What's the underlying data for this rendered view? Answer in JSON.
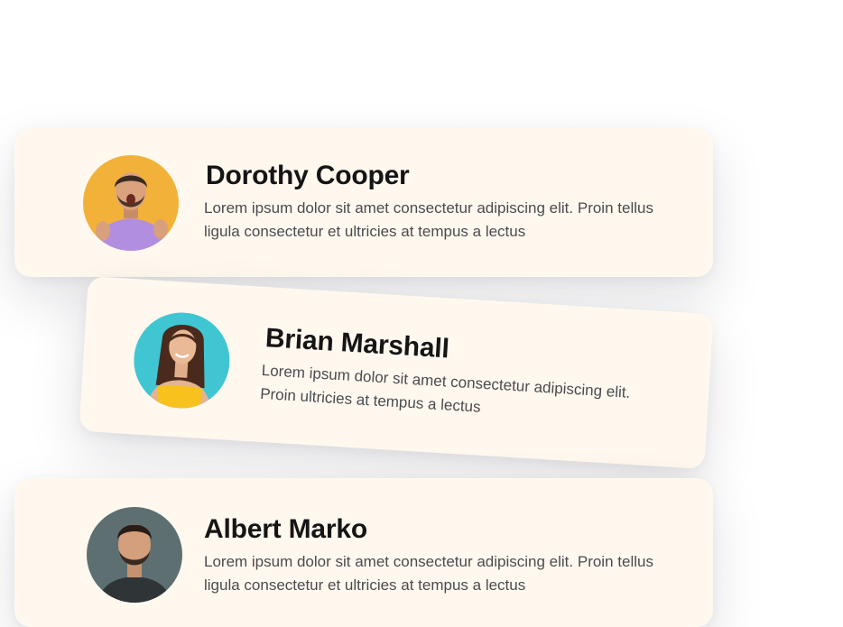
{
  "testimonials": [
    {
      "name": "Dorothy Cooper",
      "text": "Lorem ipsum dolor sit amet consectetur adipiscing elit. Proin tellus ligula consectetur et ultricies at tempus a lectus",
      "avatar_bg": "#f2b23a"
    },
    {
      "name": "Brian Marshall",
      "text": "Lorem ipsum dolor sit amet consectetur adipiscing elit. Proin ultricies at tempus a lectus",
      "avatar_bg": "#3fc6d2"
    },
    {
      "name": "Albert Marko",
      "text": "Lorem ipsum dolor sit amet consectetur adipiscing elit. Proin tellus ligula consectetur et ultricies at tempus a lectus",
      "avatar_bg": "#5e6f72"
    }
  ],
  "colors": {
    "card_bg": "#fff8ef",
    "name_color": "#151515",
    "text_color": "#4b4b4f"
  }
}
